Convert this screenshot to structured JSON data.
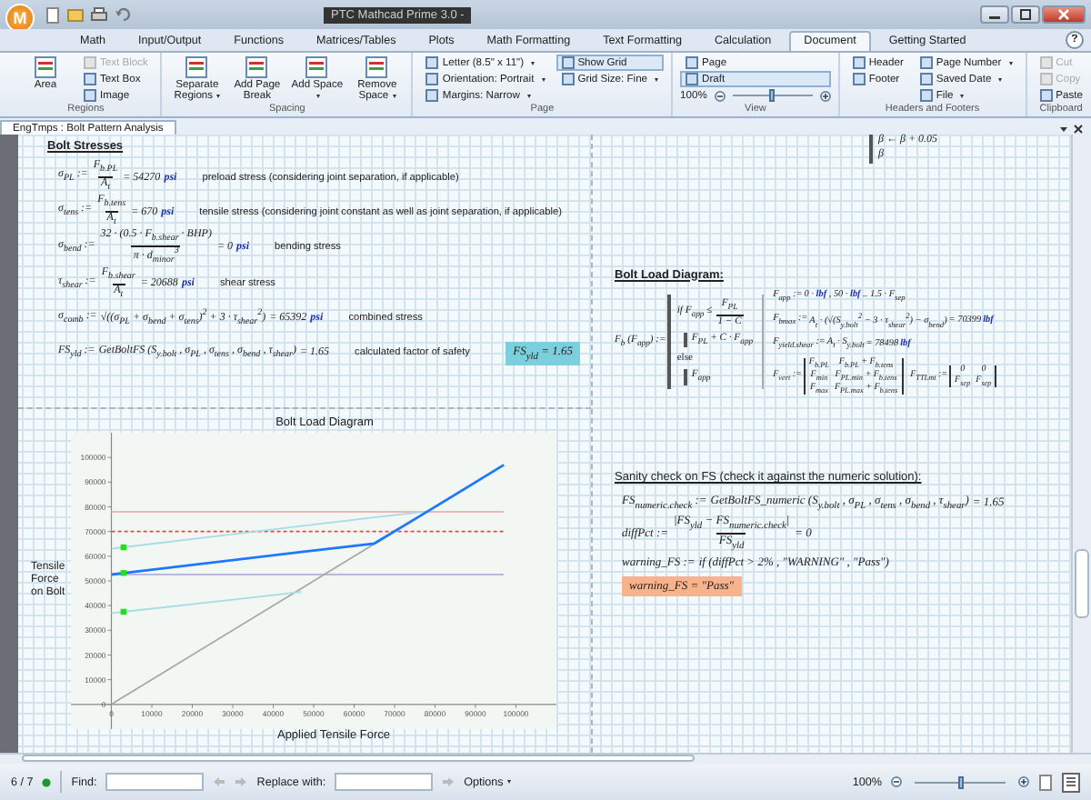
{
  "app": {
    "logo": "M",
    "title": "PTC Mathcad Prime 3.0 -"
  },
  "tabs": [
    {
      "label": "Math",
      "selected": false
    },
    {
      "label": "Input/Output",
      "selected": false
    },
    {
      "label": "Functions",
      "selected": false
    },
    {
      "label": "Matrices/Tables",
      "selected": false
    },
    {
      "label": "Plots",
      "selected": false
    },
    {
      "label": "Math Formatting",
      "selected": false
    },
    {
      "label": "Text Formatting",
      "selected": false
    },
    {
      "label": "Calculation",
      "selected": false
    },
    {
      "label": "Document",
      "selected": true
    },
    {
      "label": "Getting Started",
      "selected": false
    }
  ],
  "help": "?",
  "ribbon": [
    {
      "label": "Regions",
      "columns": [
        [
          {
            "kind": "large",
            "label": "Area",
            "disabled": false
          }
        ],
        [
          {
            "kind": "small",
            "label": "Text Block",
            "disabled": true
          },
          {
            "kind": "small",
            "label": "Text Box",
            "disabled": false
          },
          {
            "kind": "small",
            "label": "Image",
            "disabled": false
          }
        ]
      ]
    },
    {
      "label": "Spacing",
      "columns": [
        [
          {
            "kind": "large",
            "label": "Separate Regions",
            "disabled": false,
            "dropdown": true
          }
        ],
        [
          {
            "kind": "large",
            "label": "Add Page Break",
            "disabled": false
          }
        ],
        [
          {
            "kind": "large",
            "label": "Add Space",
            "disabled": false,
            "dropdown": true
          }
        ],
        [
          {
            "kind": "large",
            "label": "Remove Space",
            "disabled": false,
            "dropdown": true
          }
        ]
      ]
    },
    {
      "label": "Page",
      "columns": [
        [
          {
            "kind": "small",
            "label": "Letter (8.5\" x 11\")",
            "disabled": false,
            "dropdown": true
          },
          {
            "kind": "small",
            "label": "Orientation: Portrait",
            "disabled": false,
            "dropdown": true
          },
          {
            "kind": "small",
            "label": "Margins: Narrow",
            "disabled": false,
            "dropdown": true
          }
        ],
        [
          {
            "kind": "small",
            "label": "Show Grid",
            "disabled": false,
            "selected": true
          },
          {
            "kind": "small",
            "label": "Grid Size: Fine",
            "disabled": false,
            "dropdown": true
          }
        ]
      ]
    },
    {
      "label": "View",
      "columns": [
        [
          {
            "kind": "small",
            "label": "Page",
            "disabled": false,
            "selected": false
          },
          {
            "kind": "small",
            "label": "Draft",
            "disabled": false,
            "selected": true
          },
          {
            "kind": "zoom",
            "label": "100%",
            "level": 0.5
          }
        ]
      ]
    },
    {
      "label": "Headers and Footers",
      "columns": [
        [
          {
            "kind": "small",
            "label": "Header",
            "disabled": false
          },
          {
            "kind": "small",
            "label": "Footer",
            "disabled": false
          }
        ],
        [
          {
            "kind": "small",
            "label": "Page Number",
            "disabled": false,
            "dropdown": true
          },
          {
            "kind": "small",
            "label": "Saved Date",
            "disabled": false,
            "dropdown": true
          },
          {
            "kind": "small",
            "label": "File",
            "disabled": false,
            "dropdown": true
          }
        ]
      ]
    },
    {
      "label": "Clipboard",
      "columns": [
        [
          {
            "kind": "small",
            "label": "Cut",
            "disabled": true
          },
          {
            "kind": "small",
            "label": "Copy",
            "disabled": true
          },
          {
            "kind": "small",
            "label": "Paste",
            "disabled": false
          }
        ]
      ]
    }
  ],
  "document_tab": {
    "label": "EngTmps : Bolt Pattern Analysis"
  },
  "stresses": {
    "heading": "Bolt Stresses",
    "rows": [
      {
        "lhs": "σ$_{PL}$ :=",
        "num": "F$_{b.PL}$",
        "den": "A$_{t}$",
        "result": "= 54270",
        "unit": "psi",
        "comment": "preload stress (considering joint separation, if applicable)"
      },
      {
        "lhs": "σ$_{tens}$ :=",
        "num": "F$_{b.tens}$",
        "den": "A$_{t}$",
        "result": "= 670",
        "unit": "psi",
        "comment": "tensile stress (considering joint constant as well as joint separation, if applicable)"
      },
      {
        "lhs": "σ$_{bend}$ :=",
        "num": "32 · (0.5 · F$_{b.shear}$ · BHP)",
        "den": "π · d$_{minor}$$^{3}$",
        "result": "= 0",
        "unit": "psi",
        "comment": "bending stress"
      },
      {
        "lhs": "τ$_{shear}$ :=",
        "num": "F$_{b.shear}$",
        "den": "A$_{t}$",
        "result": "= 20688",
        "unit": "psi",
        "comment": "shear stress"
      },
      {
        "lhs": "σ$_{comb}$ :=",
        "expr": "√((σ$_{PL}$ + σ$_{bend}$ + σ$_{tens}$)$^{2}$ + 3 · τ$_{shear}$$^{2}$)",
        "result": "= 65392",
        "unit": "psi",
        "comment": "combined stress"
      },
      {
        "lhs": "FS$_{yld}$ :=",
        "expr": "GetBoltFS (S$_{y.bolt}$ , σ$_{PL}$ , σ$_{tens}$ , σ$_{bend}$ , τ$_{shear}$)",
        "result": "= 1.65",
        "comment": "calculated factor of safety",
        "highlight": "FS$_{yld}$ = 1.65",
        "color": "#7ccfdc"
      }
    ]
  },
  "chart": {
    "chart_data": {
      "type": "line",
      "title": "Bolt Load Diagram",
      "xlabel": "Applied Tensile Force",
      "ylabel": "Tensile Force on Bolt",
      "x": [
        0,
        3000,
        47000,
        65000,
        77000,
        97000
      ],
      "xlim": [
        -10000,
        110000
      ],
      "ylim": [
        -10000,
        110000
      ],
      "xticks": [
        0,
        10000,
        20000,
        30000,
        40000,
        50000,
        60000,
        70000,
        80000,
        90000,
        100000
      ],
      "yticks": [
        0,
        10000,
        20000,
        30000,
        40000,
        50000,
        60000,
        70000,
        80000,
        90000,
        100000
      ],
      "series": [
        {
          "color": "#f2b5b5",
          "values": [
            78000,
            78000,
            78000,
            78000,
            78000,
            78000
          ]
        },
        {
          "color": "#b8b8e0",
          "values": [
            52600,
            52600,
            52600,
            52600,
            52600,
            52600
          ]
        },
        {
          "color": "#ff3b3b",
          "line_style": "dashed",
          "values": [
            70000,
            70000,
            70000,
            70000,
            70000,
            70000
          ]
        },
        {
          "color": "#a8a8a8",
          "values": [
            0,
            3000,
            47000,
            65000,
            null,
            null
          ]
        },
        {
          "color": "#a6dce4",
          "values": [
            63000,
            63600,
            72200,
            75700,
            78000,
            null
          ]
        },
        {
          "color": "#a6dce4",
          "values": [
            37000,
            37500,
            45500,
            null,
            null,
            null
          ]
        },
        {
          "color": "#1e78ff",
          "values": [
            52600,
            53200,
            61700,
            65200,
            77000,
            97000
          ]
        },
        {
          "color": "#22dd22",
          "marker": true,
          "values": [
            null,
            63600,
            null,
            null,
            null,
            null
          ]
        },
        {
          "color": "#22dd22",
          "marker": true,
          "values": [
            null,
            53200,
            null,
            null,
            null,
            null
          ]
        },
        {
          "color": "#22dd22",
          "marker": true,
          "values": [
            null,
            37500,
            null,
            null,
            null,
            null
          ]
        }
      ]
    }
  },
  "program_fragment": [
    "β ← β + 0.05",
    "β"
  ],
  "load_diagram": {
    "heading": "Bolt Load Diagram:",
    "function": {
      "lhs": "F$_{b}$ (F$_{app}$) :=",
      "lines": [
        {
          "kind": "condition",
          "text": "if F$_{app}$ ≤",
          "num": "F$_{PL}$",
          "den": "1 − C"
        },
        {
          "kind": "body",
          "text": "F$_{PL}$ + C · F$_{app}$"
        },
        {
          "kind": "keyword",
          "text": "else"
        },
        {
          "kind": "body",
          "text": "F$_{app}$"
        }
      ]
    },
    "rows": [
      {
        "lhs": "F$_{app}$ :=",
        "expr": "0 · **lbf** , 50 · **lbf** .. 1.5 · F$_{sep}$"
      },
      {
        "lhs": "F$_{bmax}$ :=",
        "expr": "A$_{t}$ · (√(S$_{y.bolt}$$^{2}$ − 3 · τ$_{shear}$$^{2}$) − σ$_{bend}$)",
        "result": "= 70399",
        "unit": "lbf"
      },
      {
        "lhs": "F$_{yield.shear}$ :=",
        "expr": "A$_{t}$ · S$_{y.bolt}$",
        "result": "= 78498",
        "unit": "lbf"
      }
    ],
    "matrices": [
      {
        "lhs": "F$_{vert}$ :=",
        "cells": [
          [
            "F$_{b.PL}$",
            "F$_{b.PL}$ + F$_{b.tens}$"
          ],
          [
            "F$_{min}$",
            "F$_{PL.min}$ + F$_{b.tens}$"
          ],
          [
            "F$_{max}$",
            "F$_{PL.max}$ + F$_{b.tens}$"
          ]
        ]
      },
      {
        "lhs": "F$_{TTLmt}$ :=",
        "cells": [
          [
            "0",
            "0"
          ],
          [
            "F$_{sep}$",
            "F$_{sep}$"
          ]
        ]
      }
    ]
  },
  "sanity": {
    "heading": "Sanity check on FS (check it against the numeric solution):",
    "rows": [
      {
        "lhs": "FS$_{numeric.check}$ :=",
        "expr": "GetBoltFS_numeric (S$_{y.bolt}$ , σ$_{PL}$ , σ$_{tens}$ , σ$_{bend}$ , τ$_{shear}$)",
        "result": "= 1.65"
      },
      {
        "lhs": "diffPct :=",
        "num": "|FS$_{yld}$ − FS$_{numeric.check}$|",
        "den": "FS$_{yld}$",
        "result": "= 0"
      },
      {
        "lhs": "warning_FS :=",
        "expr": "if (diffPct > 2% , \"WARNING\" , \"Pass\")"
      },
      {
        "highlight": "warning_FS = \"Pass\"",
        "color": "#f7b48c"
      }
    ]
  },
  "status_bar": {
    "page": "6 / 7",
    "find_label": "Find:",
    "replace_label": "Replace with:",
    "options": "Options",
    "zoom": "100%",
    "zoom_slider": {
      "level": 0.5
    }
  }
}
